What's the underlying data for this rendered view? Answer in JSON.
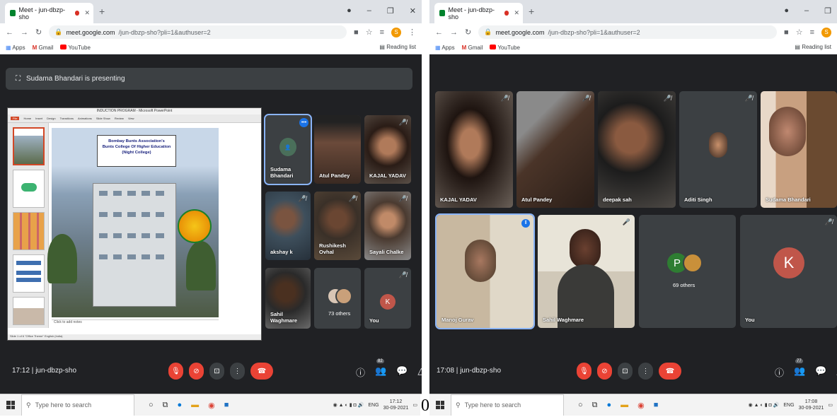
{
  "left": {
    "tab_title": "Meet - jun-dbzp-sho",
    "url_host": "meet.google.com",
    "url_path": "/jun-dbzp-sho?pli=1&authuser=2",
    "bookmarks": [
      "Apps",
      "Gmail",
      "YouTube"
    ],
    "reading_list": "Reading list",
    "presenting_text": "Sudama Bhandari is presenting",
    "ppt_title": "INDUCTION PROGRAM - Microsoft PowerPoint",
    "ppt_tabs": [
      "File",
      "Home",
      "Insert",
      "Design",
      "Transitions",
      "Animations",
      "Slide Show",
      "Review",
      "View"
    ],
    "slide_banner": [
      "Bombay Bunts Association's",
      "Bunts College Of Higher Education",
      "(Night College)"
    ],
    "notes_placeholder": "Click to add notes",
    "ppt_status": "Slide 1 of 6   \"Office Theme\"   English (India)",
    "tiles": [
      {
        "name": "Sudama Bhandari"
      },
      {
        "name": "Atul Pandey"
      },
      {
        "name": "KAJAL YADAV"
      },
      {
        "name": "akshay k"
      },
      {
        "name": "Rushikesh Ovhal"
      },
      {
        "name": "Sayali Chalke"
      },
      {
        "name": "Sahil Waghmare"
      },
      {
        "name": "73 others"
      },
      {
        "name": "You",
        "initial": "K"
      }
    ],
    "time": "17:12",
    "meeting_code": "jun-dbzp-sho",
    "people_count": "82",
    "tray_time": "17:12",
    "tray_date": "30-09-2021",
    "tray_lang": "ENG"
  },
  "right": {
    "tab_title": "Meet - jun-dbzp-sho",
    "url_host": "meet.google.com",
    "url_path": "/jun-dbzp-sho?pli=1&authuser=2",
    "bookmarks": [
      "Apps",
      "Gmail",
      "YouTube"
    ],
    "reading_list": "Reading list",
    "tiles": [
      {
        "name": "KAJAL YADAV"
      },
      {
        "name": "Atul Pandey"
      },
      {
        "name": "deepak sah"
      },
      {
        "name": "Aditi Singh"
      },
      {
        "name": "Sudama Bhandari"
      },
      {
        "name": "Manoj Gurav"
      },
      {
        "name": "Sahil Waghmare"
      },
      {
        "name": "69 others",
        "initial": "P"
      },
      {
        "name": "You",
        "initial": "K"
      }
    ],
    "time": "17:08",
    "meeting_code": "jun-dbzp-sho",
    "people_count": "77",
    "tray_time": "17:08",
    "tray_date": "30-09-2021",
    "tray_lang": "ENG"
  },
  "taskbar_search": "Type here to search",
  "gap_char": "0",
  "colors": {
    "meet_bg": "#202124",
    "tile": "#3c4043",
    "red": "#ea4335",
    "active": "#8ab4f8"
  }
}
